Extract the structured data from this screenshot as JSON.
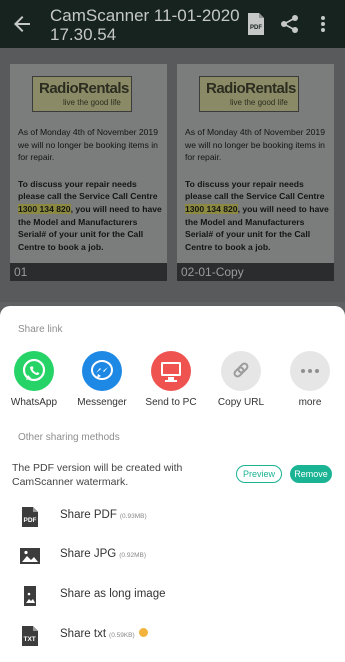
{
  "appbar": {
    "title": "CamScanner 11-01-2020 17.30.54"
  },
  "thumbs": [
    {
      "label": "01",
      "logo_big": "RadioRentals",
      "logo_small": "live the good life",
      "para1": "As of Monday 4th of November 2019 we will no longer be booking items in for repair.",
      "para2a": "To discuss your repair needs please call the Service Call Centre ",
      "phone": "1300 134 820",
      "para2b": ", you will need to have the Model and Manufacturers Serial# of your unit for the Call Centre to book a job."
    },
    {
      "label": "02-01-Copy",
      "logo_big": "RadioRentals",
      "logo_small": "live the good life",
      "para1": "As of Monday 4th of November 2019 we will no longer be booking items in for repair.",
      "para2a": "To discuss your repair needs please call the Service Call Centre ",
      "phone": "1300 134 820",
      "para2b": ", you will need to have the Model and Manufacturers Serial# of your unit for the Call Centre to book a job."
    }
  ],
  "sheet": {
    "share_link_title": "Share link",
    "share_items": [
      {
        "label": "WhatsApp",
        "icon": "whatsapp-icon",
        "color": "#25d366"
      },
      {
        "label": "Messenger",
        "icon": "messenger-icon",
        "color": "#1e88e5"
      },
      {
        "label": "Send to PC",
        "icon": "monitor-icon",
        "color": "#ef5350"
      },
      {
        "label": "Copy URL",
        "icon": "link-icon",
        "color": "#e6e6e6"
      },
      {
        "label": "more",
        "icon": "more-dots-icon",
        "color": "#e6e6e6"
      }
    ],
    "other_methods_title": "Other sharing methods",
    "watermark_notice": "The PDF version will be created with CamScanner watermark.",
    "preview_label": "Preview",
    "remove_label": "Remove",
    "options": [
      {
        "name": "Share PDF",
        "size": "(0.93MB)",
        "icon": "pdf-file-icon"
      },
      {
        "name": "Share JPG",
        "size": "(0.92MB)",
        "icon": "image-icon"
      },
      {
        "name": "Share as long image",
        "size": "",
        "icon": "long-image-icon"
      },
      {
        "name": "Share txt",
        "size": "(0.59KB)",
        "icon": "txt-file-icon"
      }
    ],
    "accent_color": "#1ab394"
  }
}
